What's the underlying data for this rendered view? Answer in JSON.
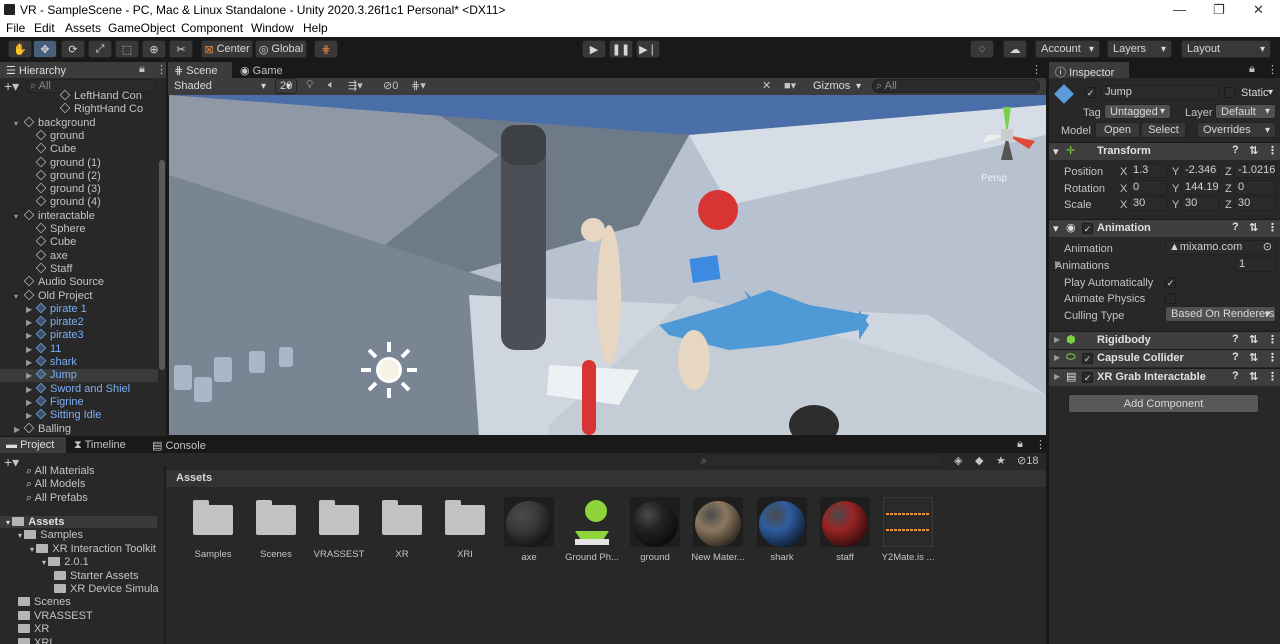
{
  "window": {
    "title": "VR - SampleScene - PC, Mac & Linux Standalone - Unity 2020.3.26f1c1 Personal* <DX11>",
    "controls": [
      "—",
      "❐",
      "✕"
    ]
  },
  "menu": [
    "File",
    "Edit",
    "Assets",
    "GameObject",
    "Component",
    "Window",
    "Help"
  ],
  "toolbar": {
    "center": "Center",
    "global": "Global",
    "account": "Account",
    "layers": "Layers",
    "layout": "Layout"
  },
  "hierarchy": {
    "tab": "Hierarchy",
    "search_placeholder": "All",
    "items": [
      {
        "label": "LeftHand Con",
        "depth": 4
      },
      {
        "label": "RightHand Co",
        "depth": 4
      },
      {
        "label": "background",
        "depth": 1,
        "expanded": true
      },
      {
        "label": "ground",
        "depth": 2
      },
      {
        "label": "Cube",
        "depth": 2
      },
      {
        "label": "ground (1)",
        "depth": 2
      },
      {
        "label": "ground (2)",
        "depth": 2
      },
      {
        "label": "ground (3)",
        "depth": 2
      },
      {
        "label": "ground (4)",
        "depth": 2
      },
      {
        "label": "interactable",
        "depth": 1,
        "expanded": true
      },
      {
        "label": "Sphere",
        "depth": 2
      },
      {
        "label": "Cube",
        "depth": 2
      },
      {
        "label": "axe",
        "depth": 2
      },
      {
        "label": "Staff",
        "depth": 2
      },
      {
        "label": "Audio Source",
        "depth": 1
      },
      {
        "label": "Old Project",
        "depth": 1,
        "expanded": true
      },
      {
        "label": "pirate 1",
        "depth": 2,
        "blue": true
      },
      {
        "label": "pirate2",
        "depth": 2,
        "blue": true
      },
      {
        "label": "pirate3",
        "depth": 2,
        "blue": true
      },
      {
        "label": "11",
        "depth": 2,
        "blue": true
      },
      {
        "label": "shark",
        "depth": 2,
        "blue": true
      },
      {
        "label": "Jump",
        "depth": 2,
        "blue": true,
        "selected": true
      },
      {
        "label": "Sword and Shiel",
        "depth": 2,
        "blue": true
      },
      {
        "label": "Figrine",
        "depth": 2,
        "blue": true
      },
      {
        "label": "Sitting Idle",
        "depth": 2,
        "blue": true
      },
      {
        "label": "Balling",
        "depth": 1
      }
    ]
  },
  "scene": {
    "tabs": [
      "Scene",
      "Game"
    ],
    "shading": "Shaded",
    "mode2d": "20",
    "hidden_count": "0",
    "gizmos": "Gizmos",
    "search_placeholder": "All",
    "persp": "Persp"
  },
  "inspector": {
    "tab": "Inspector",
    "object_name": "Jump",
    "static": "Static",
    "tag_label": "Tag",
    "tag": "Untagged",
    "layer_label": "Layer",
    "layer": "Default",
    "model_label": "Model",
    "open": "Open",
    "select": "Select",
    "overrides": "Overrides",
    "transform": {
      "title": "Transform",
      "position_label": "Position",
      "rotation_label": "Rotation",
      "scale_label": "Scale",
      "position": {
        "x": "1.3",
        "y": "-2.346",
        "z": "-1.0216"
      },
      "rotation": {
        "x": "0",
        "y": "144.19",
        "z": "0"
      },
      "scale": {
        "x": "30",
        "y": "30",
        "z": "30"
      }
    },
    "animation": {
      "title": "Animation",
      "animation_label": "Animation",
      "animation_value": "mixamo.com",
      "animations_label": "Animations",
      "animations_count": "1",
      "play_auto_label": "Play Automatically",
      "animate_physics_label": "Animate Physics",
      "culling_label": "Culling Type",
      "culling_value": "Based On Renderers"
    },
    "components": [
      "Rigidbody",
      "Capsule Collider",
      "XR Grab Interactable"
    ],
    "add_component": "Add Component"
  },
  "bottom": {
    "tabs": [
      "Project",
      "Timeline",
      "Console"
    ],
    "search_placeholder": "",
    "hidden_count": "18",
    "favorites": [
      "All Materials",
      "All Models",
      "All Prefabs"
    ],
    "tree": [
      {
        "label": "Assets",
        "depth": 0,
        "bold": true
      },
      {
        "label": "Samples",
        "depth": 1
      },
      {
        "label": "XR Interaction Toolkit",
        "depth": 2
      },
      {
        "label": "2.0.1",
        "depth": 3
      },
      {
        "label": "Starter Assets",
        "depth": 4
      },
      {
        "label": "XR Device Simula",
        "depth": 4
      },
      {
        "label": "Scenes",
        "depth": 1
      },
      {
        "label": "VRASSEST",
        "depth": 1
      },
      {
        "label": "XR",
        "depth": 1
      },
      {
        "label": "XRI",
        "depth": 1
      }
    ],
    "breadcrumb": "Assets",
    "assets": [
      {
        "label": "Samples",
        "kind": "folder"
      },
      {
        "label": "Scenes",
        "kind": "folder"
      },
      {
        "label": "VRASSEST",
        "kind": "folder"
      },
      {
        "label": "XR",
        "kind": "folder"
      },
      {
        "label": "XRI",
        "kind": "folder"
      },
      {
        "label": "axe",
        "kind": "material",
        "color": "#3a3a3a"
      },
      {
        "label": "Ground Ph...",
        "kind": "physic"
      },
      {
        "label": "ground",
        "kind": "material",
        "color": "#222222"
      },
      {
        "label": "New Mater...",
        "kind": "material",
        "color": "#8c7860"
      },
      {
        "label": "shark",
        "kind": "material",
        "color": "#2f5d9e"
      },
      {
        "label": "staff",
        "kind": "material",
        "color": "#9a2424"
      },
      {
        "label": "Y2Mate.is ...",
        "kind": "audio"
      }
    ]
  },
  "colors": {
    "accent": "#46607c",
    "link": "#7bb0f5",
    "bg": "#282828",
    "header": "#3c3c3c"
  }
}
